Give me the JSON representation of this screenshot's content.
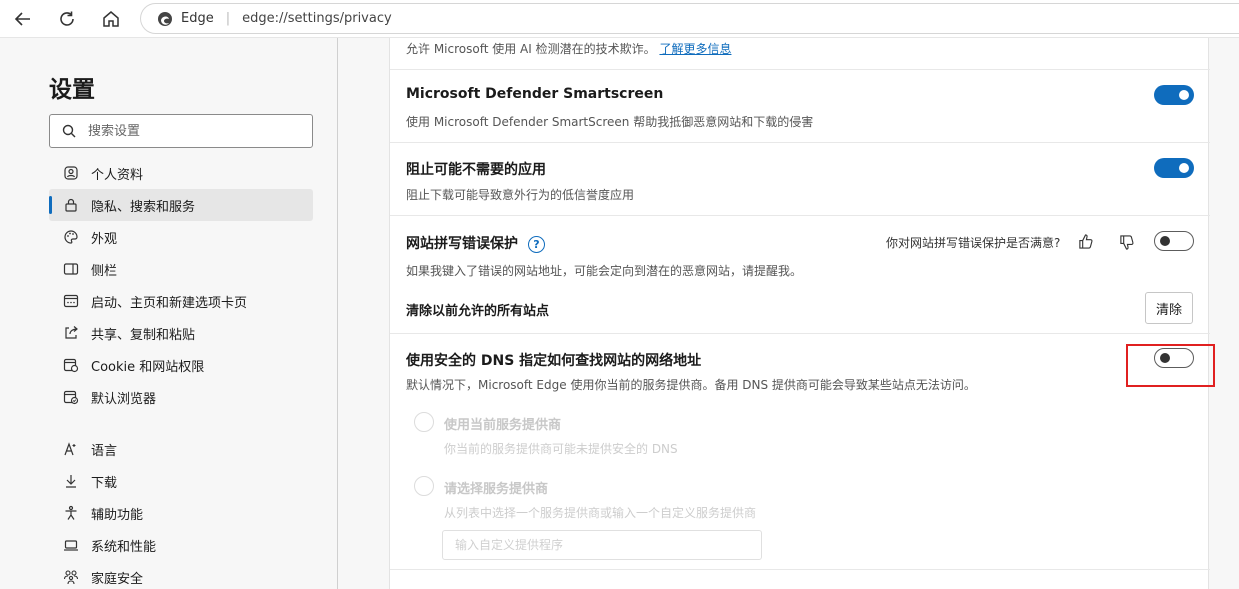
{
  "browser": {
    "label": "Edge",
    "url": "edge://settings/privacy"
  },
  "sidebar": {
    "title": "设置",
    "search_placeholder": "搜索设置",
    "items": [
      {
        "label": "个人资料",
        "icon": "profile-icon"
      },
      {
        "label": "隐私、搜索和服务",
        "icon": "lock-icon",
        "active": true
      },
      {
        "label": "外观",
        "icon": "palette-icon"
      },
      {
        "label": "侧栏",
        "icon": "sidebar-icon"
      },
      {
        "label": "启动、主页和新建选项卡页",
        "icon": "home-tab-icon"
      },
      {
        "label": "共享、复制和粘贴",
        "icon": "share-icon"
      },
      {
        "label": "Cookie 和网站权限",
        "icon": "cookie-icon"
      },
      {
        "label": "默认浏览器",
        "icon": "browser-icon"
      },
      {
        "label": "语言",
        "icon": "language-icon"
      },
      {
        "label": "下载",
        "icon": "download-icon"
      },
      {
        "label": "辅助功能",
        "icon": "accessibility-icon"
      },
      {
        "label": "系统和性能",
        "icon": "system-icon"
      },
      {
        "label": "家庭安全",
        "icon": "family-icon"
      }
    ]
  },
  "main": {
    "top_partial": {
      "text": "允许 Microsoft 使用 AI 检测潜在的技术欺诈。",
      "link": "了解更多信息"
    },
    "smartscreen": {
      "title": "Microsoft Defender Smartscreen",
      "desc": "使用 Microsoft Defender SmartScreen 帮助我抵御恶意网站和下载的侵害",
      "enabled": true
    },
    "pua": {
      "title": "阻止可能不需要的应用",
      "desc": "阻止下载可能导致意外行为的低信誉度应用",
      "enabled": true
    },
    "typo": {
      "title": "网站拼写错误保护",
      "help": "?",
      "feedback_question": "你对网站拼写错误保护是否满意?",
      "desc": "如果我键入了错误的网站地址，可能会定向到潜在的恶意网站，请提醒我。",
      "enabled": false,
      "clear_label": "清除以前允许的所有站点",
      "clear_button": "清除"
    },
    "dns": {
      "title": "使用安全的 DNS 指定如何查找网站的网络地址",
      "desc": "默认情况下，Microsoft Edge 使用你当前的服务提供商。备用 DNS 提供商可能会导致某些站点无法访问。",
      "enabled": false,
      "option1_title": "使用当前服务提供商",
      "option1_desc": "你当前的服务提供商可能未提供安全的 DNS",
      "option2_title": "请选择服务提供商",
      "option2_desc": "从列表中选择一个服务提供商或输入一个自定义服务提供商",
      "custom_placeholder": "输入自定义提供程序"
    }
  },
  "colors": {
    "accent": "#0f6cbd",
    "highlight": "#e02020"
  }
}
